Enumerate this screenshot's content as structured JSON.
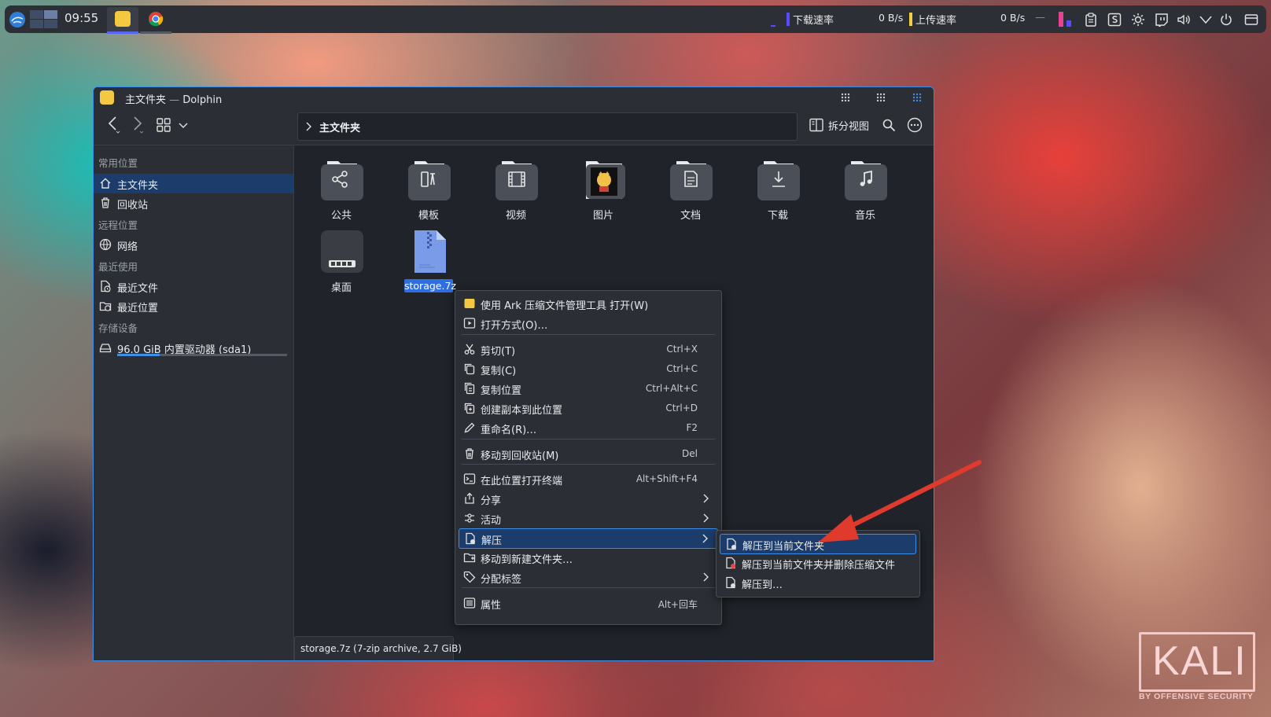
{
  "panel": {
    "clock": "09:55",
    "download_label": "下载速率",
    "download_value": "0 B/s",
    "upload_label": "上传速率",
    "upload_value": "0 B/s",
    "separator": "—"
  },
  "window": {
    "title_main": "主文件夹",
    "title_sep": " — ",
    "title_app": "Dolphin",
    "accent": "#3d8ee6"
  },
  "toolbar": {
    "breadcrumb": "主文件夹",
    "split_view": "拆分视图"
  },
  "sidebar": {
    "sections": [
      {
        "heading": "常用位置",
        "items": [
          {
            "label": "主文件夹",
            "icon": "home-icon",
            "selected": true
          },
          {
            "label": "回收站",
            "icon": "trash-icon"
          }
        ]
      },
      {
        "heading": "远程位置",
        "items": [
          {
            "label": "网络",
            "icon": "network-icon"
          }
        ]
      },
      {
        "heading": "最近使用",
        "items": [
          {
            "label": "最近文件",
            "icon": "recent-files-icon"
          },
          {
            "label": "最近位置",
            "icon": "recent-locations-icon"
          }
        ]
      },
      {
        "heading": "存储设备",
        "items": [
          {
            "label": "96.0 GiB 内置驱动器 (sda1)",
            "icon": "drive-icon",
            "usage_fraction": 0.25
          }
        ]
      }
    ]
  },
  "files": [
    {
      "name": "公共",
      "icon": "share-icon"
    },
    {
      "name": "模板",
      "icon": "template-icon"
    },
    {
      "name": "视频",
      "icon": "video-icon"
    },
    {
      "name": "图片",
      "icon": "pictures-icon"
    },
    {
      "name": "文档",
      "icon": "document-icon"
    },
    {
      "name": "下载",
      "icon": "download-icon"
    },
    {
      "name": "音乐",
      "icon": "music-icon"
    },
    {
      "name": "桌面",
      "icon": "desktop-icon"
    },
    {
      "name": "storage.7z",
      "icon": "archive-icon",
      "selected": true
    }
  ],
  "statusbar": {
    "text": "storage.7z (7-zip archive, 2.7 GiB)"
  },
  "context_menu": [
    {
      "label": "使用 Ark 压缩文件管理工具 打开(W)",
      "icon": "ark-icon"
    },
    {
      "label": "打开方式(O)…",
      "icon": "open-with-icon"
    },
    {
      "label": "剪切(T)",
      "shortcut": "Ctrl+X",
      "icon": "cut-icon"
    },
    {
      "label": "复制(C)",
      "shortcut": "Ctrl+C",
      "icon": "copy-icon"
    },
    {
      "label": "复制位置",
      "shortcut": "Ctrl+Alt+C",
      "icon": "copy-location-icon"
    },
    {
      "label": "创建副本到此位置",
      "shortcut": "Ctrl+D",
      "icon": "duplicate-icon"
    },
    {
      "label": "重命名(R)…",
      "shortcut": "F2",
      "icon": "rename-icon"
    },
    {
      "label": "移动到回收站(M)",
      "shortcut": "Del",
      "icon": "trash-icon"
    },
    {
      "label": "在此位置打开终端",
      "shortcut": "Alt+Shift+F4",
      "icon": "terminal-icon"
    },
    {
      "label": "分享",
      "icon": "share-icon",
      "submenu": true
    },
    {
      "label": "活动",
      "icon": "activities-icon",
      "submenu": true
    },
    {
      "label": "解压",
      "icon": "extract-icon",
      "submenu": true,
      "highlighted": true
    },
    {
      "label": "移动到新建文件夹…",
      "icon": "new-folder-icon"
    },
    {
      "label": "分配标签",
      "icon": "tag-icon",
      "submenu": true
    },
    {
      "label": "属性",
      "shortcut": "Alt+回车",
      "icon": "properties-icon"
    }
  ],
  "submenu": [
    {
      "label": "解压到当前文件夹",
      "icon": "extract-here-icon",
      "highlighted": true
    },
    {
      "label": "解压到当前文件夹并删除压缩文件",
      "icon": "extract-delete-icon"
    },
    {
      "label": "解压到…",
      "icon": "extract-to-icon"
    }
  ],
  "watermark": {
    "logo_text": "KALI",
    "tagline": "BY OFFENSIVE SECURITY"
  },
  "colors": {
    "accent": "#3d8ee6",
    "highlight_bg": "#1c3d6b",
    "arrow": "#e03a2c",
    "download_bar": "#5b4bff",
    "upload_bar": "#f0d040"
  }
}
